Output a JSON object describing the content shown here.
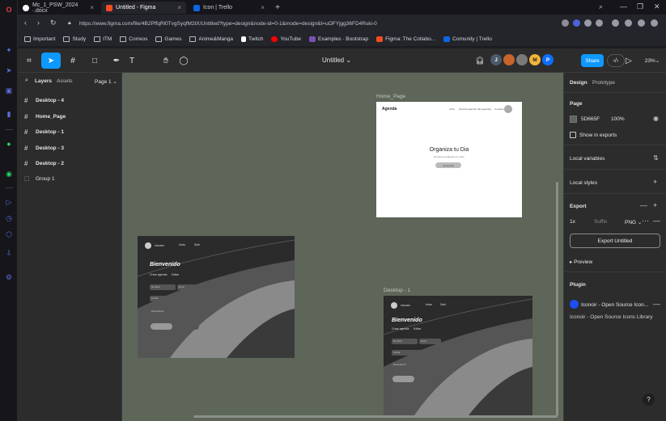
{
  "browser": {
    "tabs": [
      {
        "title": "Mc_1_PSW_2024 ∙.docx",
        "active": false,
        "favicon_color": "#ffffff"
      },
      {
        "title": "Untitled - Figma",
        "active": true,
        "favicon_color": "#f24e1e"
      },
      {
        "title": "Icon | Trello",
        "active": false,
        "favicon_color": "#0c66e4"
      }
    ],
    "url": "https://www.figma.com/file/4B2PffqRl0TvgSyqfM2tX/Untitled?type=design&node-id=0-1&mode=design&t=uOFYjgg36FD4Rski-0",
    "bookmarks": [
      {
        "label": "Important",
        "icon": "folder-icon"
      },
      {
        "label": "Study",
        "icon": "folder-icon"
      },
      {
        "label": "ITM",
        "icon": "folder-icon"
      },
      {
        "label": "Correos",
        "icon": "folder-icon"
      },
      {
        "label": "Games",
        "icon": "folder-icon"
      },
      {
        "label": "Anime&Manga",
        "icon": "folder-icon"
      },
      {
        "label": "Twitch",
        "icon": "page-icon"
      },
      {
        "label": "YouTube",
        "icon": "youtube-icon"
      },
      {
        "label": "Examples · Bootstrap",
        "icon": "bootstrap-icon"
      },
      {
        "label": "Figma: The Collabo...",
        "icon": "figma-icon"
      },
      {
        "label": "Comunity | Trello",
        "icon": "trello-icon"
      }
    ]
  },
  "figma": {
    "file_title": "Untitled",
    "zoom": "23%",
    "share_label": "Share",
    "avatars": [
      {
        "initial": "J",
        "color": "#4a5a6a"
      },
      {
        "initial": "",
        "color": "#c7632b"
      },
      {
        "initial": "",
        "color": "#7a7a7a"
      },
      {
        "initial": "M",
        "color": "#f2b43a"
      },
      {
        "initial": "P",
        "color": "#0d6efd"
      }
    ],
    "left_panel": {
      "tab_layers": "Layers",
      "tab_assets": "Assets",
      "page_selector": "Page 1",
      "layers": [
        {
          "name": "Desktop - 4",
          "type": "frame"
        },
        {
          "name": "Home_Page",
          "type": "frame"
        },
        {
          "name": "Desktop - 1",
          "type": "frame"
        },
        {
          "name": "Desktop - 3",
          "type": "frame"
        },
        {
          "name": "Desktop - 2",
          "type": "frame"
        },
        {
          "name": "Group 1",
          "type": "group"
        }
      ]
    },
    "canvas": {
      "background": "#5D665F",
      "home_label": "Home_Page",
      "desktop1_label": "Desktop - 1",
      "home": {
        "brand": "Agenda",
        "nav": [
          "Inicio",
          "Nuestra agenda",
          "Mis agendas",
          "Contacto"
        ],
        "headline": "Organiza tu Dia",
        "sub": "Empieza a planear con todo",
        "cta": "Comenzar"
      },
      "desktop": {
        "user": "Usuario",
        "nav": [
          "Inicio",
          "Salir"
        ],
        "welcome": "Bienvenido",
        "links": [
          "Crear agenda",
          "Editar"
        ],
        "fields": [
          "Nombre",
          "Fecha",
          "Descripción"
        ],
        "field2": "Hora"
      }
    },
    "right_panel": {
      "tab_design": "Design",
      "tab_prototype": "Prototype",
      "page_heading": "Page",
      "page_color": "5D665F",
      "page_opacity": "100%",
      "show_in_exports": "Show in exports",
      "local_variables": "Local variables",
      "local_styles": "Local styles",
      "export_heading": "Export",
      "export_scale": "1x",
      "export_suffix": "Suffix",
      "export_format": "PNG",
      "export_button": "Export Untitled",
      "preview": "Preview",
      "plugin_heading": "Plugin",
      "plugin_name": "Iconoir - Open Source Icon...",
      "plugin_desc": "Iconoir - Open Source Icons Library",
      "help": "?"
    }
  }
}
